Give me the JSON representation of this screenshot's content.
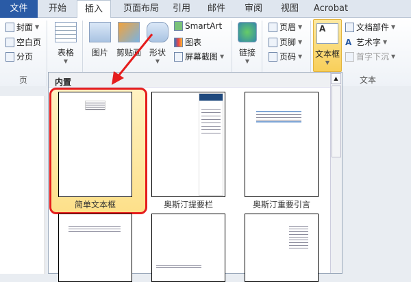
{
  "tabs": [
    "文件",
    "开始",
    "插入",
    "页面布局",
    "引用",
    "邮件",
    "审阅",
    "视图",
    "Acrobat"
  ],
  "active_tab": "插入",
  "ribbon": {
    "pages": {
      "items": [
        "封面",
        "空白页",
        "分页"
      ],
      "label": "页"
    },
    "table": "表格",
    "illustrations": {
      "picture": "图片",
      "clipart": "剪贴画",
      "shapes": "形状",
      "smartart": "SmartArt",
      "chart": "图表",
      "screenshot": "屏幕截图"
    },
    "links": "链接",
    "header_footer": [
      "页眉",
      "页脚",
      "页码"
    ],
    "text": {
      "textbox": "文本框",
      "parts": "文档部件",
      "wordart": "艺术字",
      "dropcap": "首字下沉",
      "label": "文本"
    }
  },
  "gallery": {
    "header": "内置",
    "items": [
      "简单文本框",
      "奥斯汀提要栏",
      "奥斯汀重要引言",
      "",
      "",
      ""
    ],
    "selected": "简单文本框"
  },
  "colors": {
    "file_tab": "#2a5ba6",
    "highlight": "#f8cf5a",
    "annotation": "#e51d1d",
    "sidebar_blue": "#1f497d"
  }
}
